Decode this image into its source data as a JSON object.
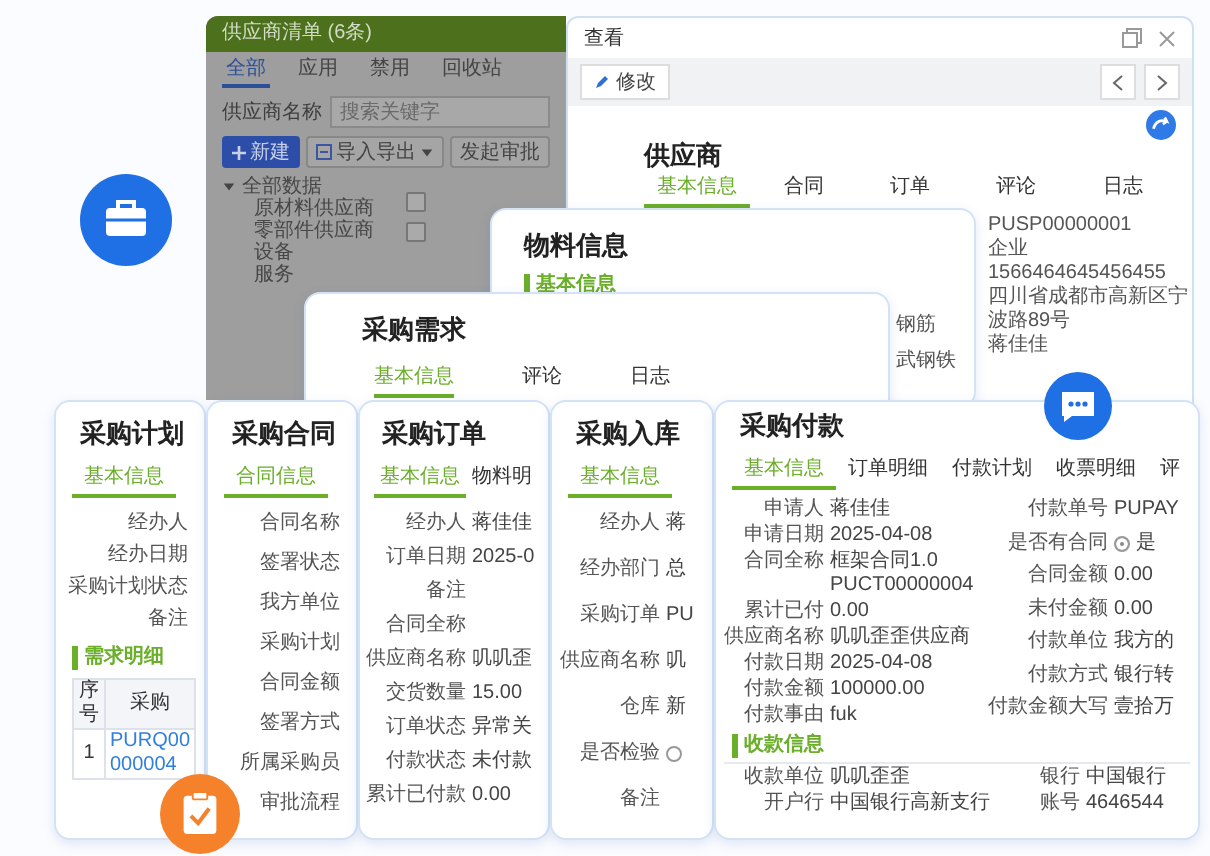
{
  "supplier_list": {
    "title": "供应商清单 (6条)",
    "tabs": [
      {
        "label": "全部",
        "selected": true
      },
      {
        "label": "应用",
        "selected": false
      },
      {
        "label": "禁用",
        "selected": false
      },
      {
        "label": "回收站",
        "selected": false
      }
    ],
    "search": {
      "label": "供应商名称",
      "placeholder": "搜索关键字"
    },
    "buttons": [
      {
        "label": "新建",
        "kind": "primary"
      },
      {
        "label": "导入导出",
        "kind": "menu"
      },
      {
        "label": "发起审批",
        "kind": "plain"
      }
    ],
    "tree": [
      {
        "label": "全部数据",
        "expanded": true,
        "children": [
          {
            "label": "原材料供应商"
          },
          {
            "label": "零部件供应商"
          },
          {
            "label": "设备"
          },
          {
            "label": "服务"
          }
        ]
      }
    ],
    "rows": [
      {
        "checked": false
      },
      {
        "checked": false
      }
    ]
  },
  "view_window": {
    "title": "查看",
    "edit_button": "修改",
    "record_title": "供应商",
    "tabs": [
      {
        "label": "基本信息",
        "selected": true
      },
      {
        "label": "合同",
        "selected": false
      },
      {
        "label": "订单",
        "selected": false
      },
      {
        "label": "评论",
        "selected": false
      },
      {
        "label": "日志",
        "selected": false
      }
    ],
    "values": [
      "PUSP00000001",
      "企业",
      "1566464645456455",
      "四川省成都市高新区宁波路89号",
      "蒋佳佳"
    ]
  },
  "material_card": {
    "title": "物料信息",
    "section": "基本信息",
    "values": [
      "钢筋",
      "武钢铁"
    ]
  },
  "requirement_card": {
    "title": "采购需求",
    "tabs": [
      {
        "label": "基本信息",
        "selected": true
      },
      {
        "label": "评论",
        "selected": false
      },
      {
        "label": "日志",
        "selected": false
      }
    ]
  },
  "plan_card": {
    "title": "采购计划",
    "tabs": [
      {
        "label": "基本信息",
        "selected": true
      }
    ],
    "fields": [
      {
        "label": "经办人"
      },
      {
        "label": "经办日期"
      },
      {
        "label": "采购计划状态"
      },
      {
        "label": "备注"
      }
    ],
    "section": "需求明细",
    "table": {
      "columns": [
        "序号",
        "采购"
      ],
      "rows": [
        [
          "1",
          "PURQ00000004"
        ]
      ]
    }
  },
  "contract_card": {
    "title": "采购合同",
    "tabs": [
      {
        "label": "合同信息",
        "selected": true
      }
    ],
    "fields": [
      {
        "label": "合同名称"
      },
      {
        "label": "签署状态"
      },
      {
        "label": "我方单位"
      },
      {
        "label": "采购计划"
      },
      {
        "label": "合同金额"
      },
      {
        "label": "签署方式"
      },
      {
        "label": "所属采购员"
      },
      {
        "label": "审批流程"
      }
    ]
  },
  "order_card": {
    "title": "采购订单",
    "tabs": [
      {
        "label": "基本信息",
        "selected": true
      },
      {
        "label": "物料明",
        "selected": false
      }
    ],
    "fields": [
      {
        "label": "经办人",
        "value": "蒋佳佳"
      },
      {
        "label": "订单日期",
        "value": "2025-0"
      },
      {
        "label": "备注"
      },
      {
        "label": "合同全称"
      },
      {
        "label": "供应商名称",
        "value": "叽叽歪"
      },
      {
        "label": "交货数量",
        "value": "15.00"
      },
      {
        "label": "订单状态",
        "value": "异常关"
      },
      {
        "label": "付款状态",
        "value": "未付款"
      },
      {
        "label": "累计已付款",
        "value": "0.00"
      }
    ]
  },
  "receipt_card": {
    "title": "采购入库",
    "tabs": [
      {
        "label": "基本信息",
        "selected": true
      }
    ],
    "fields": [
      {
        "label": "经办人",
        "value": "蒋"
      },
      {
        "label": "经办部门",
        "value": "总"
      },
      {
        "label": "采购订单",
        "value": "PU"
      },
      {
        "label": "供应商名称",
        "value": "叽"
      },
      {
        "label": "仓库",
        "value": "新"
      },
      {
        "label": "是否检验",
        "kind": "radio",
        "selected": false
      },
      {
        "label": "备注"
      }
    ]
  },
  "payment_card": {
    "title": "采购付款",
    "tabs": [
      {
        "label": "基本信息",
        "selected": true
      },
      {
        "label": "订单明细",
        "selected": false
      },
      {
        "label": "付款计划",
        "selected": false
      },
      {
        "label": "收票明细",
        "selected": false
      },
      {
        "label": "评",
        "selected": false
      }
    ],
    "left_fields": [
      {
        "label": "申请人",
        "value": "蒋佳佳"
      },
      {
        "label": "申请日期",
        "value": "2025-04-08"
      },
      {
        "label": "合同全称",
        "value": "框架合同1.0 PUCT00000004"
      },
      {
        "label": "累计已付",
        "value": "0.00"
      },
      {
        "label": "供应商名称",
        "value": "叽叽歪歪供应商"
      },
      {
        "label": "付款日期",
        "value": "2025-04-08"
      },
      {
        "label": "付款金额",
        "value": "100000.00"
      },
      {
        "label": "付款事由",
        "value": "fuk"
      }
    ],
    "right_fields": [
      {
        "label": "付款单号",
        "value": "PUPAY"
      },
      {
        "label": "是否有合同",
        "kind": "radio",
        "selected": true,
        "value": "是"
      },
      {
        "label": "合同金额",
        "value": "0.00"
      },
      {
        "label": "未付金额",
        "value": "0.00"
      },
      {
        "label": "付款单位",
        "value": "我方的"
      },
      {
        "label": "付款方式",
        "value": "银行转"
      },
      {
        "label": "付款金额大写",
        "value": "壹拾万"
      }
    ],
    "section": "收款信息",
    "bank_left": [
      {
        "label": "收款单位",
        "value": "叽叽歪歪"
      },
      {
        "label": "开户行",
        "value": "中国银行高新支行"
      }
    ],
    "bank_right": [
      {
        "label": "银行",
        "value": "中国银行"
      },
      {
        "label": "账号",
        "value": "4646544"
      }
    ]
  }
}
